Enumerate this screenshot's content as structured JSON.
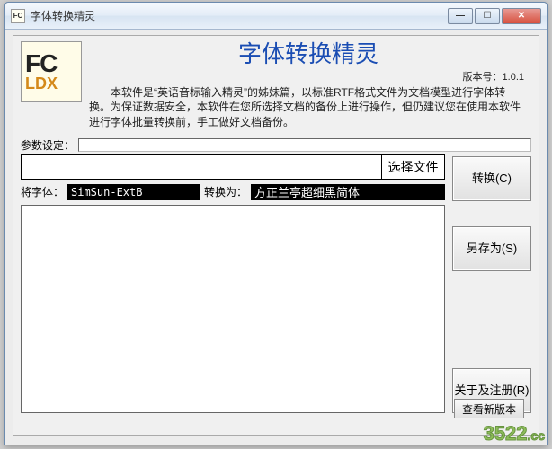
{
  "window": {
    "title": "字体转换精灵"
  },
  "logo": {
    "line1": "FC",
    "line2": "LDX"
  },
  "header": {
    "title": "字体转换精灵",
    "version_label": "版本号：",
    "version": "1.0.1",
    "description": "本软件是“英语音标输入精灵”的姊妹篇，以标准RTF格式文件为文档模型进行字体转换。为保证数据安全，本软件在您所选择文档的备份上进行操作，但仍建议您在使用本软件进行字体批量转换前，手工做好文档备份。"
  },
  "params": {
    "label": "参数设定：",
    "value": ""
  },
  "file": {
    "path": "",
    "choose_label": "选择文件"
  },
  "fonts": {
    "from_label": "将字体：",
    "from_value": "SimSun-ExtB",
    "to_label": "转换为：",
    "to_value": "方正兰亭超细黑简体"
  },
  "buttons": {
    "convert": "转换(C)",
    "saveas": "另存为(S)",
    "about": "关于及注册(R)",
    "check_new": "查看新版本"
  },
  "watermark": {
    "main": "3522",
    "suffix": ".cc"
  }
}
